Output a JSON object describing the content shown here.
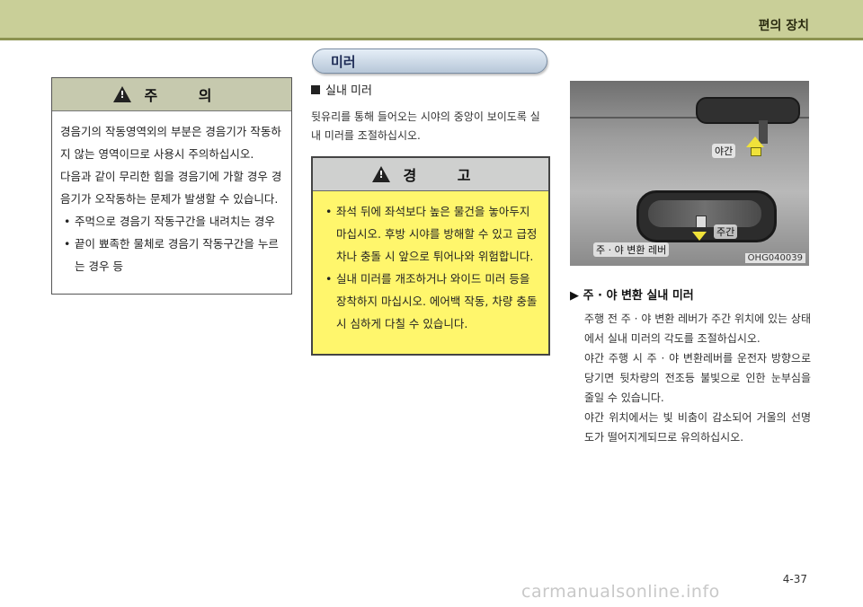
{
  "header": {
    "section_title": "편의 장치"
  },
  "caution": {
    "title": "주 의",
    "paragraphs": [
      "경음기의 작동영역외의 부분은 경음기가 작동하지 않는 영역이므로 사용시 주의하십시오.",
      "다음과 같이 무리한 힘을 경음기에 가할 경우 경음기가 오작동하는 문제가 발생할 수 있습니다."
    ],
    "bullets": [
      "주먹으로 경음기 작동구간을 내려치는 경우",
      "끝이 뾰족한 물체로 경음기 작동구간을 누르는 경우 등"
    ]
  },
  "mirror_section": {
    "title": "미러",
    "sub_heading": "실내 미러",
    "intro": "뒷유리를 통해 들어오는 시야의 중앙이 보이도록 실내 미러를 조절하십시오."
  },
  "warning": {
    "title": "경 고",
    "bullets": [
      "좌석 뒤에 좌석보다 높은 물건을 놓아두지 마십시오. 후방 시야를 방해할 수 있고 급정차나 충돌 시 앞으로 튀어나와 위험합니다.",
      "실내 미러를 개조하거나 와이드 미러 등을 장착하지 마십시오. 에어백 작동, 차량 충돌 시 심하게 다칠 수 있습니다."
    ]
  },
  "figure": {
    "label_night": "야간",
    "label_day": "주간",
    "label_lever": "주 · 야 변환 레버",
    "code": "OHG040039"
  },
  "lever_section": {
    "heading": "▶ 주 · 야 변환 실내 미러",
    "paragraphs": [
      "주행 전 주 · 야 변환 레버가 주간 위치에 있는 상태에서 실내 미러의 각도를 조절하십시오.",
      "야간 주행 시 주 · 야 변환레버를 운전자 방향으로 당기면 뒷차량의 전조등 불빛으로 인한 눈부심을 줄일 수 있습니다.",
      "야간 위치에서는 빛 비춤이 감소되어 거울의 선명도가 떨어지게되므로 유의하십시오."
    ]
  },
  "footer": {
    "page_number": "4-37",
    "watermark": "carmanualsonline.info"
  }
}
